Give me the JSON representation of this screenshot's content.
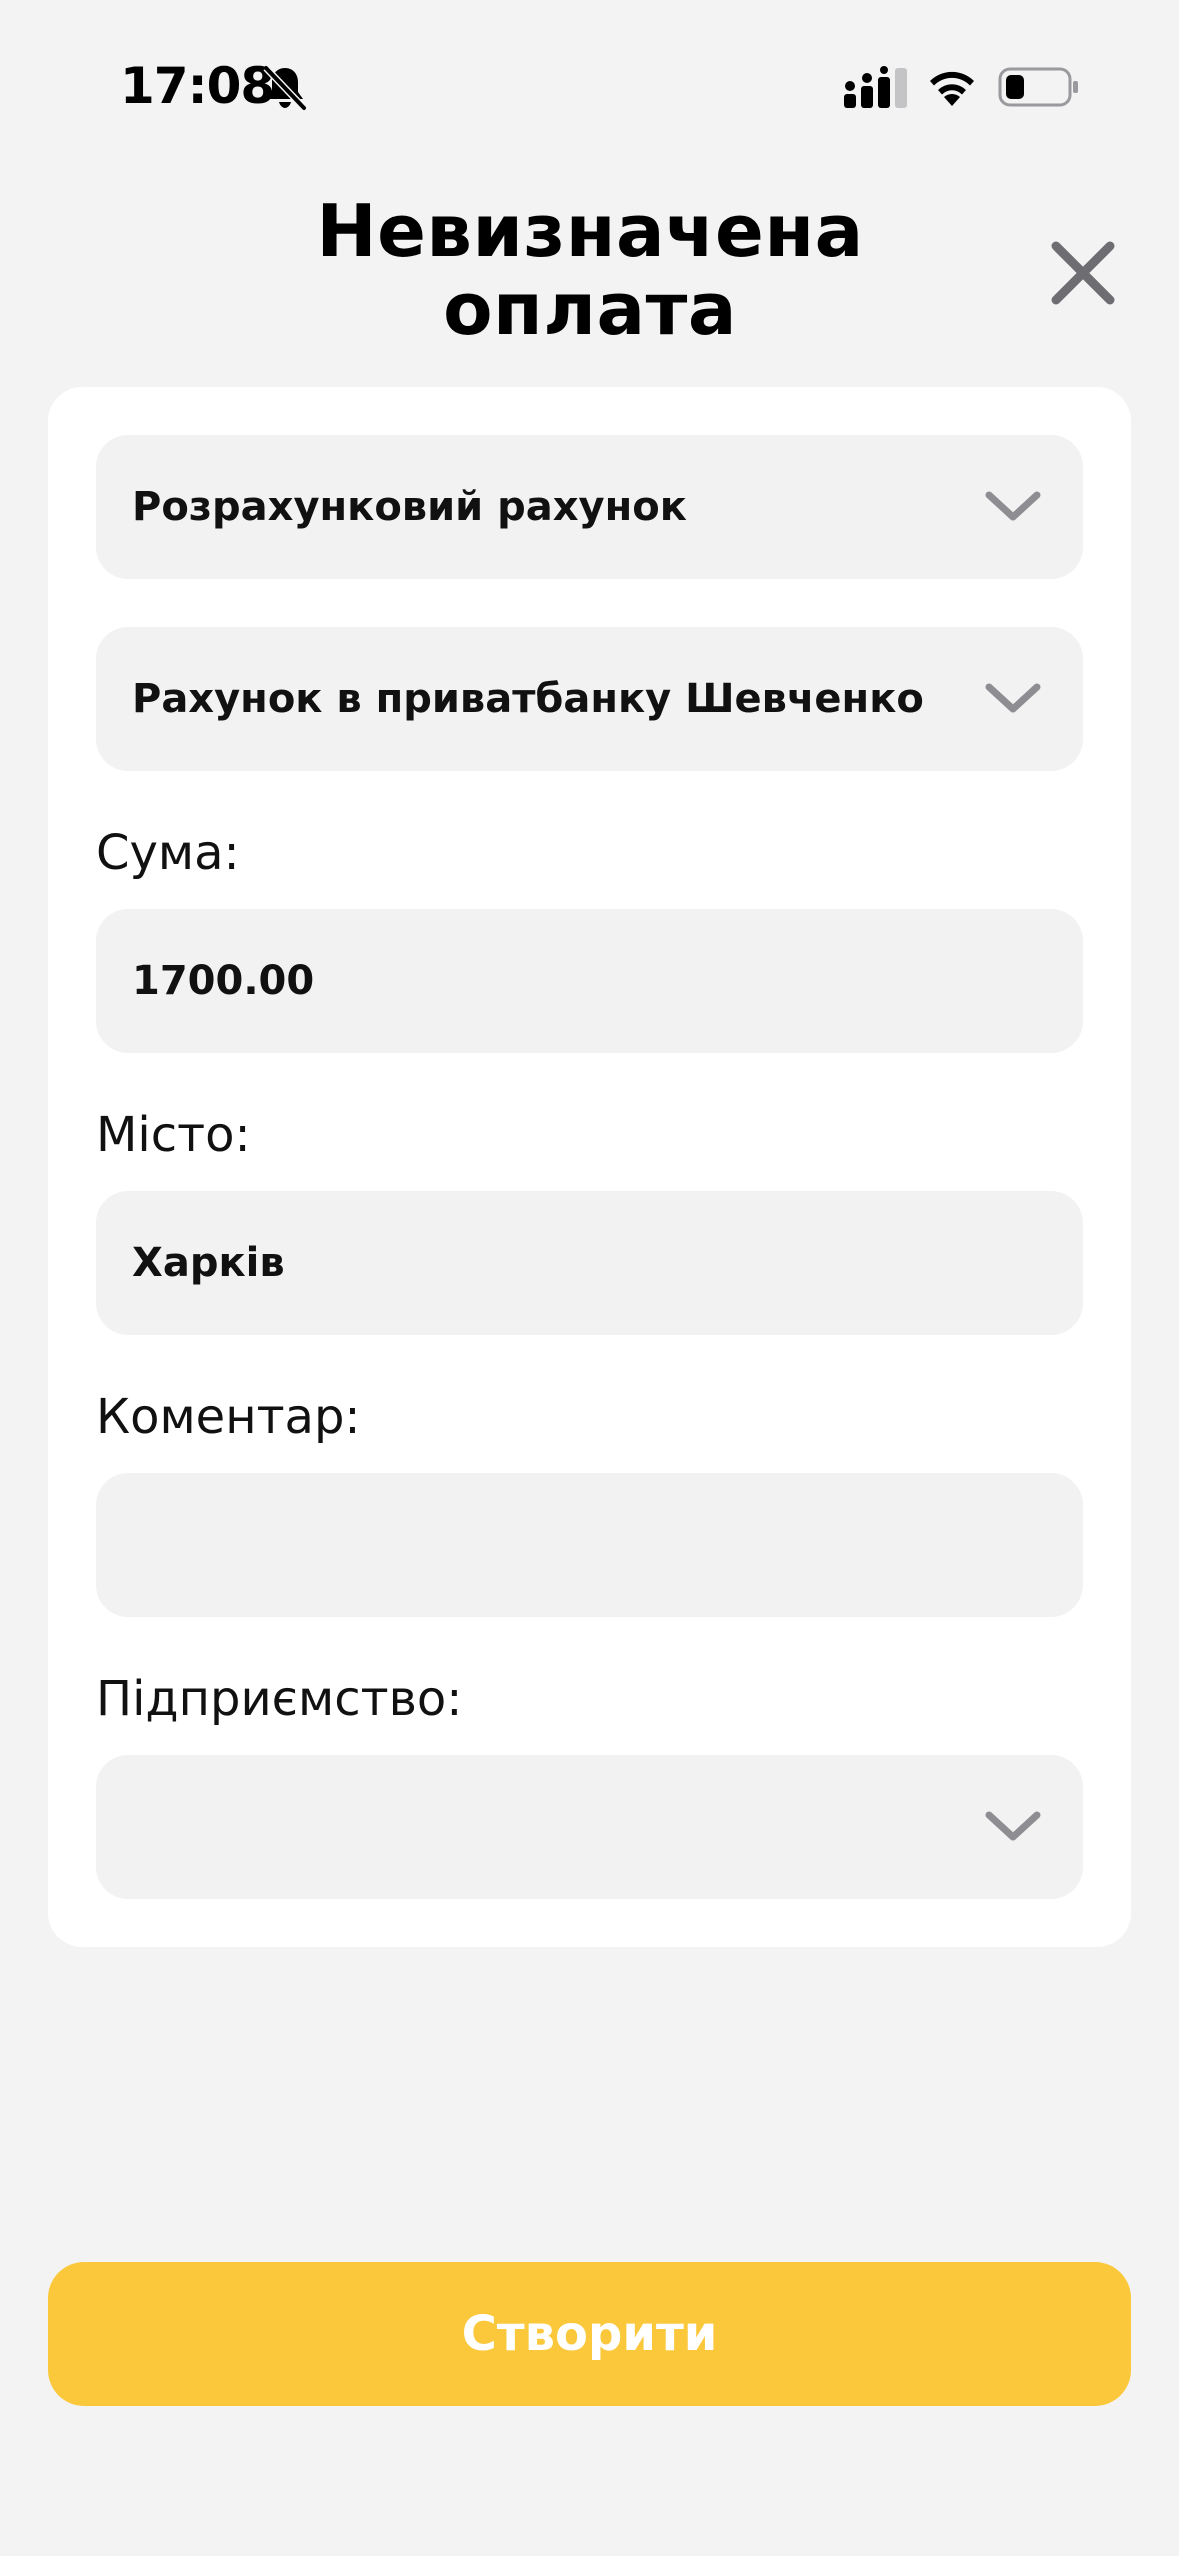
{
  "status_bar": {
    "time": "17:08"
  },
  "header": {
    "title": "Невизначена оплата"
  },
  "form": {
    "account_type_select": {
      "value": "Розрахунковий рахунок"
    },
    "account_select": {
      "value": "Рахунок в приватбанку Шевченко"
    },
    "amount": {
      "label": "Сума:",
      "value": "1700.00"
    },
    "city": {
      "label": "Місто:",
      "value": "Харків"
    },
    "comment": {
      "label": "Коментар:",
      "value": ""
    },
    "company": {
      "label": "Підприємство:",
      "value": ""
    }
  },
  "actions": {
    "create_label": "Створити"
  },
  "colors": {
    "background": "#f3f3f4",
    "card": "#ffffff",
    "field": "#f2f2f3",
    "accent": "#fac83a",
    "chevron": "#8e8e92",
    "close_icon": "#6e6e72"
  },
  "icons": {
    "close": "close-icon",
    "chevron": "chevron-down-icon",
    "bell": "bell-slash-icon",
    "signal": "cellular-signal-icon",
    "wifi": "wifi-icon",
    "battery": "battery-icon"
  }
}
